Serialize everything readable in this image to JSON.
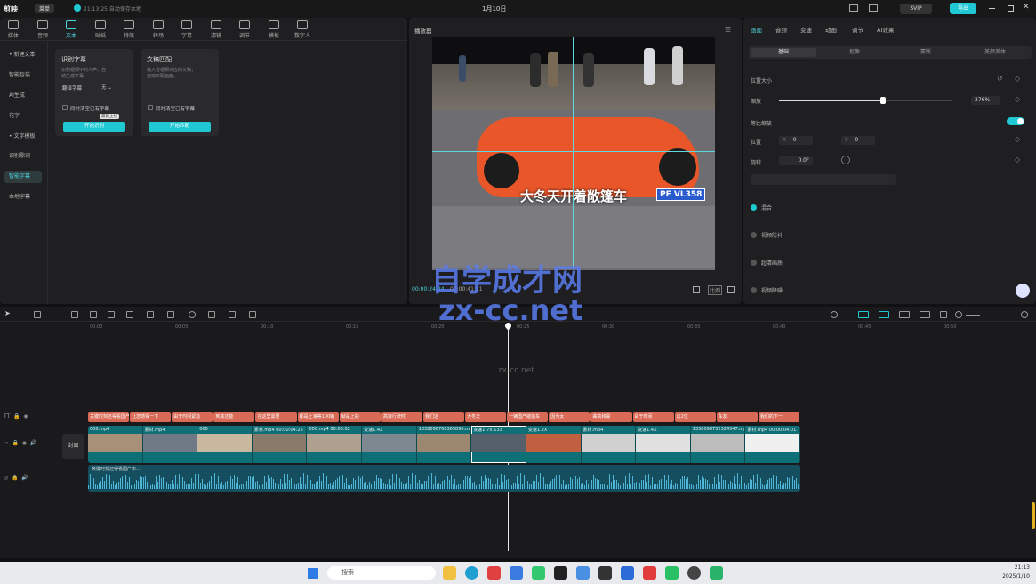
{
  "app": {
    "name": "剪映",
    "menu_label": "菜单",
    "autosave": "21:13:25 自动保存本地",
    "title": "1月10日",
    "vip_label": "SVIP",
    "export_label": "导出"
  },
  "toolbar": {
    "items": [
      {
        "label": "媒体"
      },
      {
        "label": "音频"
      },
      {
        "label": "文本"
      },
      {
        "label": "贴纸"
      },
      {
        "label": "特效"
      },
      {
        "label": "转场"
      },
      {
        "label": "字幕"
      },
      {
        "label": "滤镜"
      },
      {
        "label": "调节"
      },
      {
        "label": "模板"
      },
      {
        "label": "数字人"
      }
    ]
  },
  "sidebar": {
    "items": [
      {
        "label": "• 新建文本"
      },
      {
        "label": "智能包装"
      },
      {
        "label": "AI生成"
      },
      {
        "label": "花字"
      },
      {
        "label": "• 文字模板"
      },
      {
        "label": "识别歌词"
      },
      {
        "label": "智能字幕"
      },
      {
        "label": "本地字幕"
      }
    ]
  },
  "cards": {
    "recognize": {
      "title": "识别字幕",
      "desc1": "识别视频中的人声，自",
      "desc2": "动生成字幕。",
      "lang": "翻译字幕",
      "lang_value": "无",
      "clear": "同时清空已有字幕",
      "tooltip": "最新上线",
      "button": "开始识别"
    },
    "match": {
      "title": "文稿匹配",
      "desc1": "输入音视频对应的文稿，",
      "desc2": "自动匹配画面。",
      "clear": "同时清空已有字幕",
      "button": "开始匹配"
    }
  },
  "player": {
    "title": "播放器",
    "subtitle": "大冬天开着敞篷车",
    "plate": "PF VL358",
    "time_current": "00:00:24:24",
    "time_total": "00:00:41:21",
    "ratio": "比例",
    "watermark1": "zx-cc.net",
    "watermark_big": "自学成才网",
    "watermark_big2": "zx-cc.net"
  },
  "props": {
    "tabs": [
      "画面",
      "音频",
      "变速",
      "动画",
      "调节",
      "AI效果"
    ],
    "subtabs": [
      "基础",
      "抠像",
      "蒙版",
      "美颜美体"
    ],
    "position_size": "位置大小",
    "scale_label": "缩放",
    "scale_value": "276%",
    "scale_level": 0.6,
    "uniform_label": "等比缩放",
    "pos_label": "位置",
    "x_label": "X",
    "x_value": "0",
    "y_label": "Y",
    "y_value": "0",
    "rotate_label": "旋转",
    "rotate_value": "0.0°",
    "blend": "混合",
    "stabilize": "视频防抖",
    "denoise": "超清画质",
    "reduce": "视频降噪"
  },
  "timeline": {
    "ruler": [
      "00:00",
      "00:05",
      "00:10",
      "00:15",
      "00:20",
      "00:25",
      "00:30",
      "00:35",
      "00:40",
      "00:45",
      "00:50"
    ],
    "cover_label": "封面",
    "clips": [
      {
        "name": "000.mp4"
      },
      {
        "name": "素材.mp4"
      },
      {
        "name": "000"
      },
      {
        "name": "素材.mp4 00:00:04:25"
      },
      {
        "name": "000.mp4 00:00:02"
      },
      {
        "name": "变速1.4X"
      },
      {
        "name": "1338096768369896.mp4 00:00:10:12"
      },
      {
        "name": "变速1.7X 133"
      },
      {
        "name": "变速1.2X"
      },
      {
        "name": "素材.mp4"
      },
      {
        "name": "变速1.4X"
      },
      {
        "name": "1338098752324547.mp4"
      },
      {
        "name": "素材.mp4 00:00:04:01"
      }
    ],
    "subtitles": [
      "关键时刻还得看国产",
      "让您感受一下",
      "由于时间紧急",
      "到底还能",
      "在这里需要",
      "都是上海等100辆",
      "就是上的",
      "高速行驶时",
      "我们这",
      "大冬天",
      "一辆国产敞篷车",
      "因为太",
      "曲高和寡",
      "由于时间",
      "这2位",
      "车友",
      "我们的下一"
    ],
    "audio_label": "关键时刻还得看国产市..."
  },
  "taskbar": {
    "search": "搜索",
    "time": "21:13",
    "date": "2025/1/10"
  },
  "colors": {
    "accent": "#1fc8d2",
    "clip": "#0f6f77",
    "subtitle": "#d96a55",
    "audio": "#1f7f9a"
  }
}
